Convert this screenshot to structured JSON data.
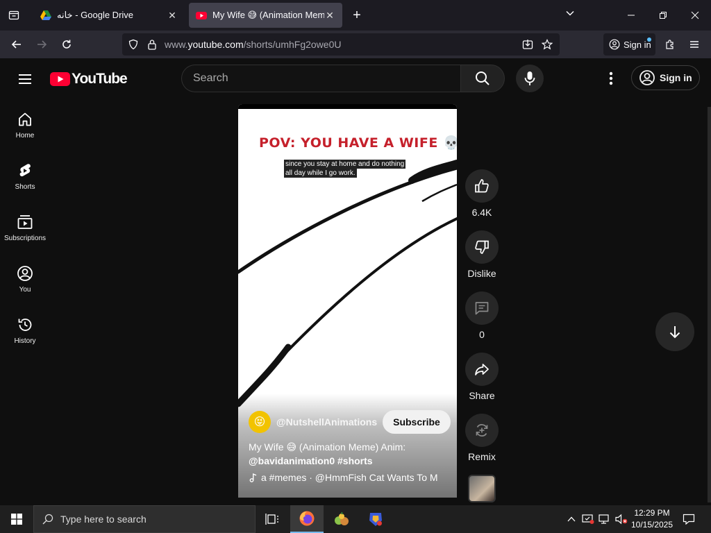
{
  "browser": {
    "tabs": [
      {
        "title": "خانه - Google Drive",
        "active": false
      },
      {
        "title": "My Wife 😅 (Animation Meme)",
        "active": true
      }
    ],
    "url_prefix": "www.",
    "url_host": "youtube.com",
    "url_path": "/shorts/umhFg2owe0U",
    "signin_label": "Sign in"
  },
  "youtube": {
    "logo_text": "YouTube",
    "search_placeholder": "Search",
    "signin_label": "Sign in",
    "guide": [
      {
        "label": "Home",
        "icon": "home-icon"
      },
      {
        "label": "Shorts",
        "icon": "shorts-icon"
      },
      {
        "label": "Subscriptions",
        "icon": "subscriptions-icon"
      },
      {
        "label": "You",
        "icon": "you-icon"
      },
      {
        "label": "History",
        "icon": "history-icon"
      }
    ],
    "short": {
      "video_title_text": "POV: YOU HAVE A WIFE 💀",
      "caption_line1": "since you stay at home and do nothing",
      "caption_line2": "all day while I go work.",
      "channel": "@NutshellAnimations",
      "subscribe_label": "Subscribe",
      "desc_text": "My Wife 😅 (Animation Meme) Anim:",
      "desc_tags": "@bavidanimation0  #shorts",
      "music_text": "a #memes · @HmmFish     Cat Wants To M"
    },
    "actions": [
      {
        "label": "6.4K",
        "icon": "like-icon"
      },
      {
        "label": "Dislike",
        "icon": "dislike-icon"
      },
      {
        "label": "0",
        "icon": "comments-icon"
      },
      {
        "label": "Share",
        "icon": "share-icon"
      },
      {
        "label": "Remix",
        "icon": "remix-icon"
      }
    ]
  },
  "taskbar": {
    "search_placeholder": "Type here to search",
    "time": "12:29 PM",
    "date": "10/15/2025"
  }
}
